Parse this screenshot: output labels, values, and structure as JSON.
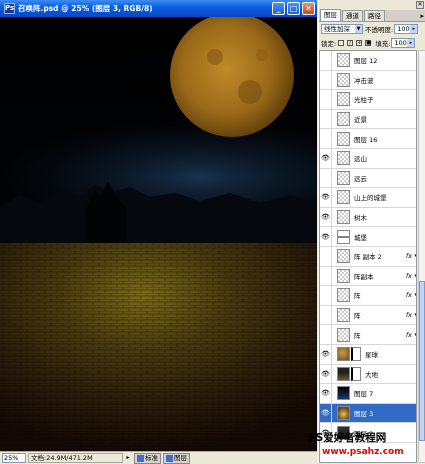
{
  "document": {
    "app_icon": "Ps",
    "title": "召唤阵.psd @ 25% (图层 3, RGB/8)",
    "buttons": {
      "minimize": "_",
      "maximize": "□",
      "close": "✕"
    }
  },
  "statusbar": {
    "zoom": "25%",
    "doc_info": "文档:24.9M/471.2M",
    "arrow": "▸",
    "taskbar_items": [
      "标准",
      "图层"
    ]
  },
  "panel": {
    "tabs": [
      "图层",
      "通道",
      "路径"
    ],
    "menu_icon": "▸",
    "close": "✕",
    "blend_mode": "线性加深",
    "opacity_label": "不透明度:",
    "opacity_value": "100%",
    "lock_label": "锁定:",
    "fill_label": "填充:",
    "fill_value": "100%",
    "layers": [
      {
        "name": "图层 12",
        "visible": false,
        "fx": false,
        "thumb": "checker"
      },
      {
        "name": "冲击波",
        "visible": false,
        "fx": false,
        "thumb": "checker"
      },
      {
        "name": "光柱子",
        "visible": false,
        "fx": false,
        "thumb": "checker"
      },
      {
        "name": "近景",
        "visible": false,
        "fx": false,
        "thumb": "checker"
      },
      {
        "name": "图层 16",
        "visible": false,
        "fx": false,
        "thumb": "checker"
      },
      {
        "name": "远山",
        "visible": true,
        "fx": false,
        "thumb": "checker"
      },
      {
        "name": "远云",
        "visible": false,
        "fx": false,
        "thumb": "checker"
      },
      {
        "name": "山上的城堡",
        "visible": true,
        "fx": false,
        "thumb": "checker"
      },
      {
        "name": "树木",
        "visible": true,
        "fx": false,
        "thumb": "checker"
      },
      {
        "name": "城堡",
        "visible": true,
        "fx": false,
        "thumb": "line"
      },
      {
        "name": "阵 副本 2",
        "visible": false,
        "fx": true,
        "thumb": "checker"
      },
      {
        "name": "阵副本",
        "visible": false,
        "fx": true,
        "thumb": "checker"
      },
      {
        "name": "阵",
        "visible": false,
        "fx": true,
        "thumb": "checker"
      },
      {
        "name": "阵",
        "visible": false,
        "fx": true,
        "thumb": "checker"
      },
      {
        "name": "阵",
        "visible": false,
        "fx": true,
        "thumb": "checker"
      },
      {
        "name": "星球",
        "visible": true,
        "fx": false,
        "thumb": "planet",
        "mask": true
      },
      {
        "name": "大地",
        "visible": true,
        "fx": false,
        "thumb": "ground",
        "mask": true
      },
      {
        "name": "图层 7",
        "visible": true,
        "fx": false,
        "thumb": "sky"
      },
      {
        "name": "图层 3",
        "visible": true,
        "fx": false,
        "thumb": "glow",
        "selected": true
      },
      {
        "name": "图层 2",
        "visible": true,
        "fx": false,
        "thumb": "dark"
      }
    ],
    "fx_label": "fx",
    "eye_glyph": "👁"
  },
  "watermark": {
    "line1": "PS爱好者教程网",
    "line2": "www.psahz.com"
  },
  "colors": {
    "titlebar": "#0552d6",
    "selection": "#316ac5",
    "moon": "#a8741c",
    "ground": "#5a4a14"
  }
}
